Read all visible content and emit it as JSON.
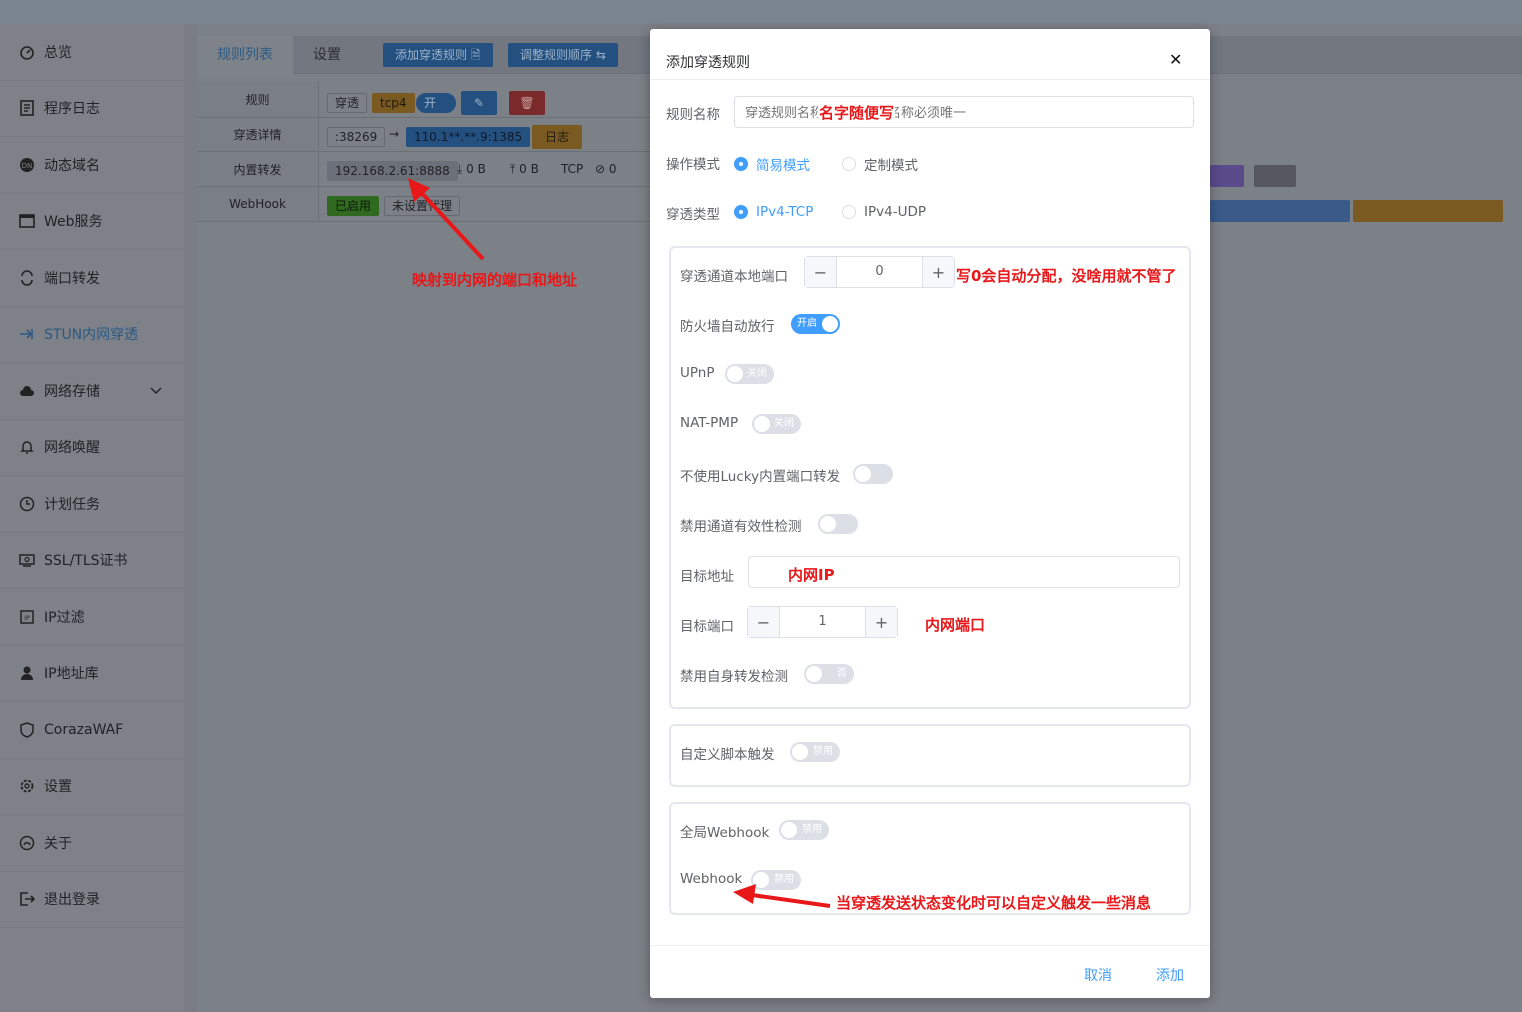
{
  "sidebar": {
    "items": [
      {
        "label": "总览",
        "icon": "dashboard-icon"
      },
      {
        "label": "程序日志",
        "icon": "log-icon"
      },
      {
        "label": "动态域名",
        "icon": "ddns-icon"
      },
      {
        "label": "Web服务",
        "icon": "web-icon"
      },
      {
        "label": "端口转发",
        "icon": "port-forward-icon"
      },
      {
        "label": "STUN内网穿透",
        "icon": "stun-icon"
      },
      {
        "label": "网络存储",
        "icon": "cloud-icon"
      },
      {
        "label": "网络唤醒",
        "icon": "bell-icon"
      },
      {
        "label": "计划任务",
        "icon": "clock-icon"
      },
      {
        "label": "SSL/TLS证书",
        "icon": "certificate-icon"
      },
      {
        "label": "IP过滤",
        "icon": "ip-filter-icon"
      },
      {
        "label": "IP地址库",
        "icon": "ip-db-icon"
      },
      {
        "label": "CorazaWAF",
        "icon": "shield-icon"
      },
      {
        "label": "设置",
        "icon": "gear-icon"
      },
      {
        "label": "关于",
        "icon": "about-icon"
      },
      {
        "label": "退出登录",
        "icon": "logout-icon"
      }
    ]
  },
  "tabs": {
    "list": "规则列表",
    "settings": "设置"
  },
  "toolbar": {
    "add_rule": "添加穿透规则",
    "reorder": "调整规则顺序"
  },
  "table": {
    "rule_label": "规则",
    "rule_tags": {
      "type": "穿透",
      "proto": "tcp4",
      "toggle": "开"
    },
    "detail_label": "穿透详情",
    "local_port": ":38269",
    "public_addr": "110.1**.**.9:1385",
    "log_btn": "日志",
    "forward_label": "内置转发",
    "forward_addr": "192.168.2.61:8888",
    "down": "0 B",
    "up": "0 B",
    "proto": "TCP",
    "conns": "0",
    "webhook_label": "WebHook",
    "webhook_enabled": "已启用",
    "proxy_unset": "未设置代理"
  },
  "modal": {
    "title": "添加穿透规则",
    "name_label": "规则名称",
    "name_placeholder": "穿透规则名称，每条规则名称必须唯一",
    "mode_label": "操作模式",
    "mode_simple": "简易模式",
    "mode_custom": "定制模式",
    "type_label": "穿透类型",
    "type_tcp": "IPv4-TCP",
    "type_udp": "IPv4-UDP",
    "local_port_label": "穿透通道本地端口",
    "local_port_value": "0",
    "firewall_label": "防火墙自动放行",
    "firewall_state": "开启",
    "upnp_label": "UPnP",
    "upnp_state": "关闭",
    "natpmp_label": "NAT-PMP",
    "natpmp_state": "关闭",
    "no_lucky_label": "不使用Lucky内置端口转发",
    "disable_check_label": "禁用通道有效性检测",
    "target_addr_label": "目标地址",
    "target_port_label": "目标端口",
    "target_port_value": "1",
    "disable_self_label": "禁用自身转发检测",
    "disable_self_state": "否",
    "script_label": "自定义脚本触发",
    "script_state": "禁用",
    "global_webhook_label": "全局Webhook",
    "global_webhook_state": "禁用",
    "webhook_label": "Webhook",
    "webhook_state": "禁用",
    "cancel": "取消",
    "add": "添加"
  },
  "annotations": {
    "name_note": "名字随便写",
    "port_note": "写0会自动分配，没啥用就不管了",
    "ip_note": "内网IP",
    "port2_note": "内网端口",
    "map_note": "映射到内网的端口和地址",
    "webhook_note": "当穿透发送状态变化时可以自定义触发一些消息"
  },
  "colors": {
    "accent": "#409eff",
    "annotation": "#e8181a"
  }
}
